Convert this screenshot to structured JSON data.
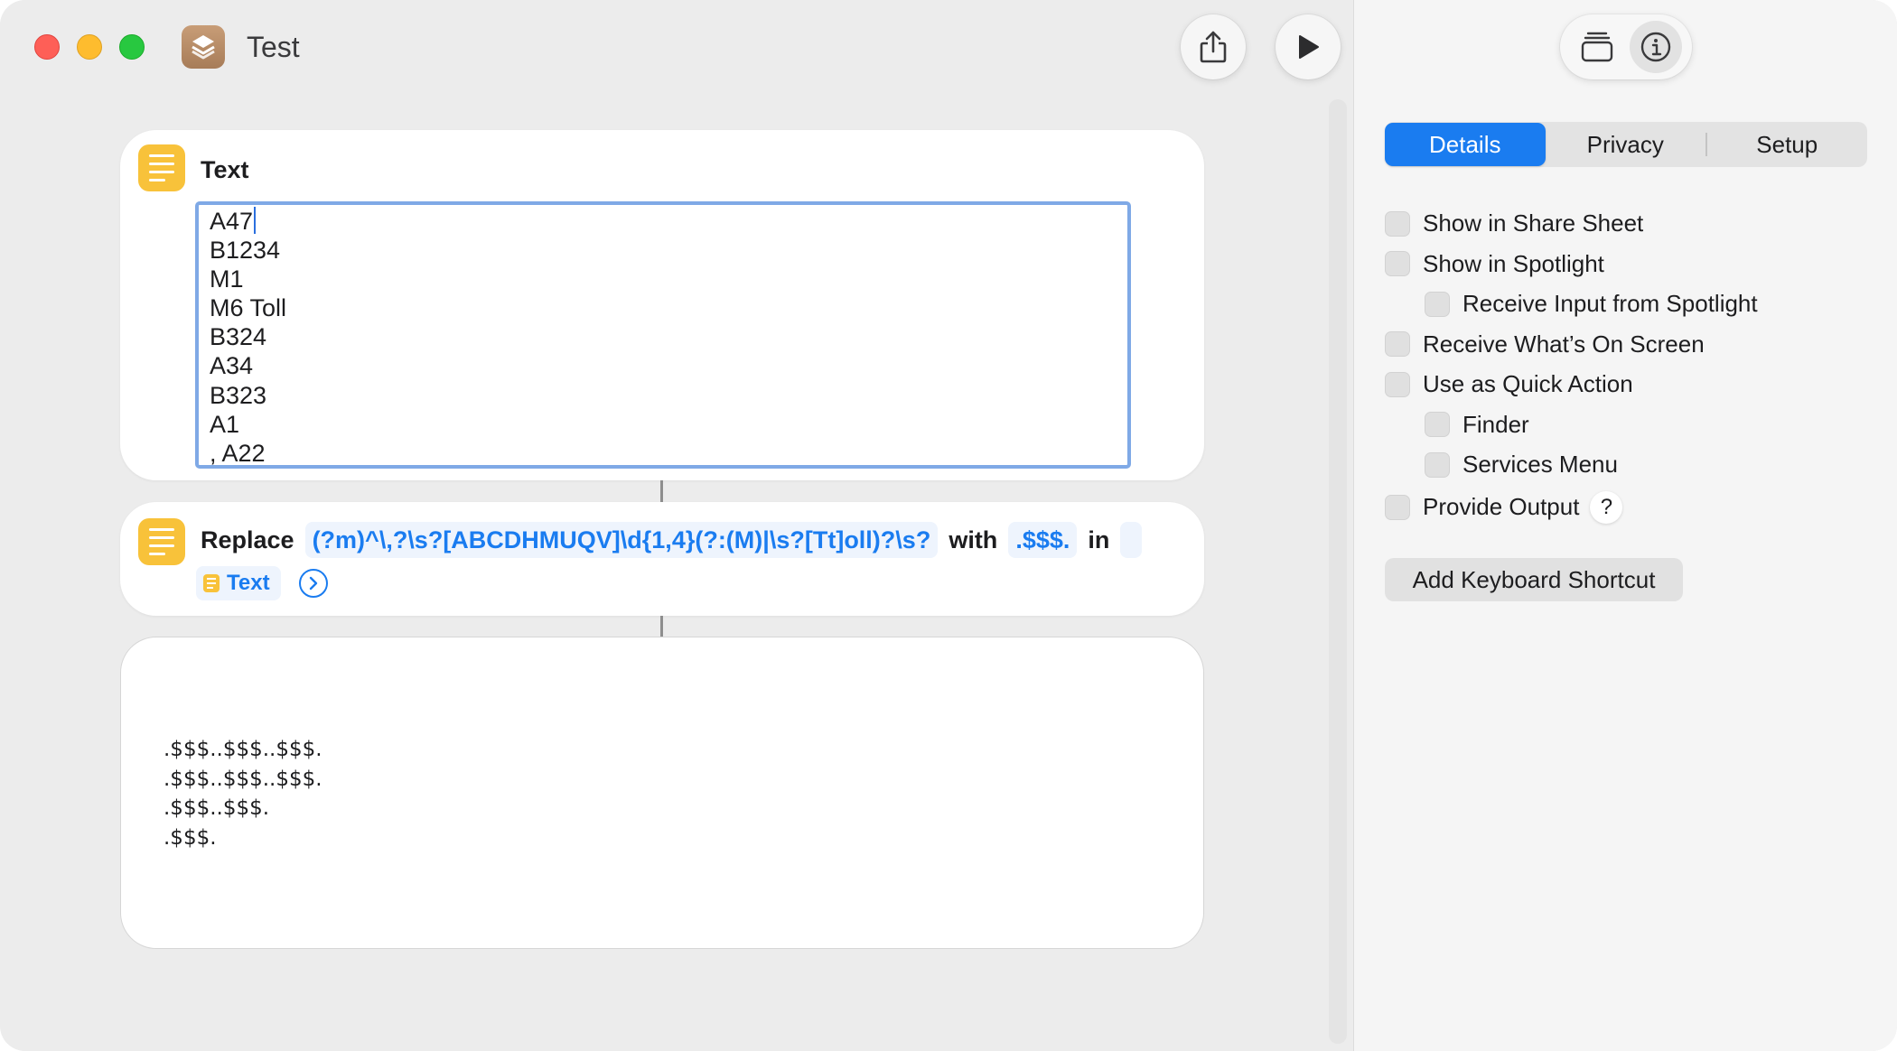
{
  "window": {
    "title": "Test"
  },
  "toolbar": {
    "share_icon": "share-icon",
    "run_icon": "play-icon"
  },
  "text_action": {
    "title": "Text",
    "lines": [
      "A47",
      "B1234",
      "M1",
      "M6 Toll",
      "B324",
      "A34",
      "B323",
      "A1",
      ", A22"
    ]
  },
  "replace_action": {
    "verb": "Replace",
    "pattern": "(?m)^\\,?\\s?[ABCDHMUQV]\\d{1,4}(?:(M)|\\s?[Tt]oll)?\\s?",
    "with_label": "with",
    "replacement": ".$$$.",
    "in_label": "in",
    "input_variable": "Text"
  },
  "output": {
    "lines": [
      ".$$$..$$$..$$$.",
      ".$$$..$$$..$$$.",
      ".$$$..$$$.",
      ".$$$."
    ]
  },
  "sidebar": {
    "tabs": [
      "Details",
      "Privacy",
      "Setup"
    ],
    "active_tab": "Details",
    "options": [
      {
        "label": "Show in Share Sheet",
        "indent": 0
      },
      {
        "label": "Show in Spotlight",
        "indent": 0
      },
      {
        "label": "Receive Input from Spotlight",
        "indent": 1
      },
      {
        "label": "Receive What’s On Screen",
        "indent": 0
      },
      {
        "label": "Use as Quick Action",
        "indent": 0
      },
      {
        "label": "Finder",
        "indent": 1
      },
      {
        "label": "Services Menu",
        "indent": 1
      },
      {
        "label": "Provide Output",
        "indent": 0
      }
    ],
    "help_glyph": "?",
    "shortcut_button": "Add Keyboard Shortcut"
  },
  "colors": {
    "accent": "#1a7cf0",
    "text_action_icon": "#f8c23a",
    "focus_ring": "#7fa9e6"
  }
}
